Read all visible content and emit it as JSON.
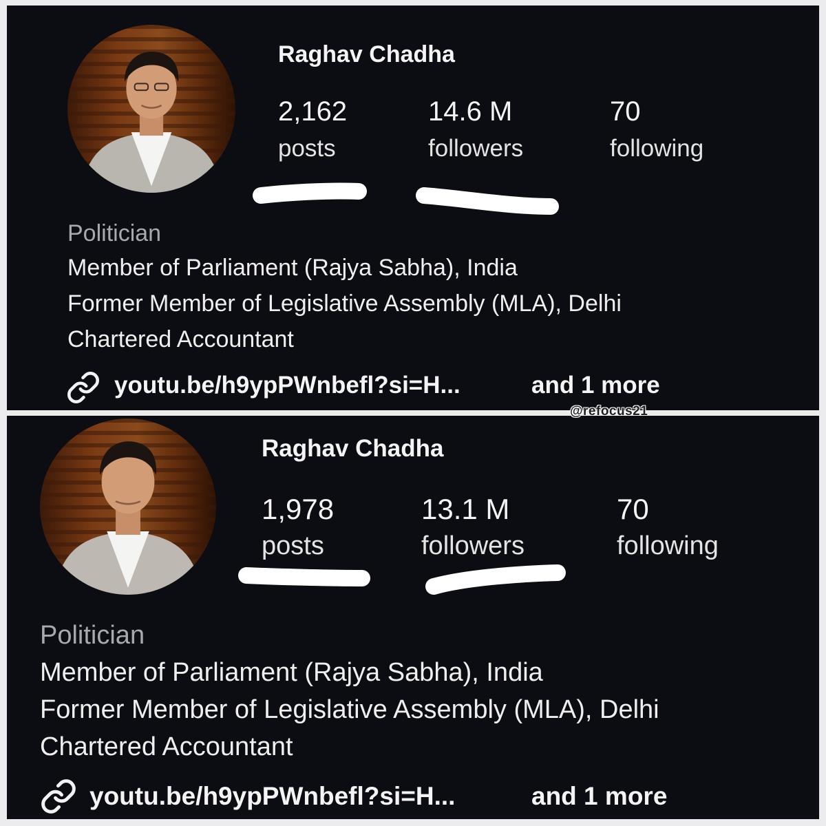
{
  "watermark": "@refocus21",
  "profiles": [
    {
      "username": "Raghav Chadha",
      "stats": [
        {
          "value": "2,162",
          "label": "posts"
        },
        {
          "value": "14.6 M",
          "label": "followers"
        },
        {
          "value": "70",
          "label": "following"
        }
      ],
      "category": "Politician",
      "bio": [
        "Member of Parliament (Rajya Sabha), India",
        "Former Member of Legislative Assembly (MLA), Delhi",
        "Chartered Accountant"
      ],
      "link": {
        "url": "youtu.be/h9ypPWnbefl?si=H...",
        "more": "and 1 more"
      }
    },
    {
      "username": "Raghav Chadha",
      "stats": [
        {
          "value": "1,978",
          "label": "posts"
        },
        {
          "value": "13.1 M",
          "label": "followers"
        },
        {
          "value": "70",
          "label": "following"
        }
      ],
      "category": "Politician",
      "bio": [
        "Member of Parliament (Rajya Sabha), India",
        "Former Member of Legislative Assembly (MLA), Delhi",
        "Chartered Accountant"
      ],
      "link": {
        "url": "youtu.be/h9ypPWnbefl?si=H...",
        "more": "and 1 more"
      }
    }
  ]
}
